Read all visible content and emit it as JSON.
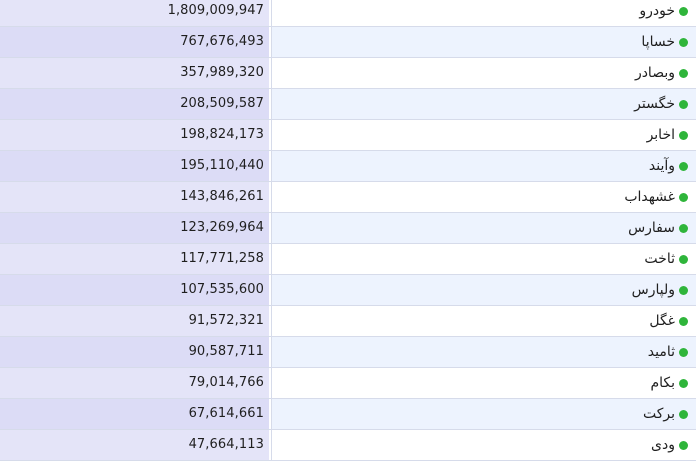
{
  "table": {
    "rows": [
      {
        "name": "خودرو",
        "value": "1,809,009,947"
      },
      {
        "name": "خساپا",
        "value": "767,676,493"
      },
      {
        "name": "وبصادر",
        "value": "357,989,320"
      },
      {
        "name": "خگستر",
        "value": "208,509,587"
      },
      {
        "name": "اخابر",
        "value": "198,824,173"
      },
      {
        "name": "وآیند",
        "value": "195,110,440"
      },
      {
        "name": "غشهداب",
        "value": "143,846,261"
      },
      {
        "name": "سفارس",
        "value": "123,269,964"
      },
      {
        "name": "ثاخت",
        "value": "117,771,258"
      },
      {
        "name": "ولپارس",
        "value": "107,535,600"
      },
      {
        "name": "غگل",
        "value": "91,572,321"
      },
      {
        "name": "ثامید",
        "value": "90,587,711"
      },
      {
        "name": "بکام",
        "value": "79,014,766"
      },
      {
        "name": "برکت",
        "value": "67,614,661"
      },
      {
        "name": "ودی",
        "value": "47,664,113"
      }
    ],
    "status_color": "#2fb53b"
  }
}
